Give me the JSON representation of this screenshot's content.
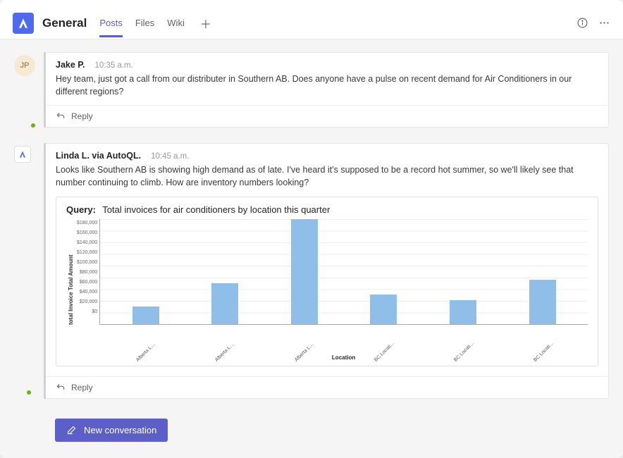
{
  "header": {
    "channel_name": "General",
    "tabs": [
      "Posts",
      "Files",
      "Wiki"
    ],
    "active_tab": 0
  },
  "messages": [
    {
      "avatar": {
        "type": "initials",
        "text": "JP",
        "presence": "available"
      },
      "author": "Jake P.",
      "time": "10:35 a.m.",
      "text": "Hey team, just got a call from our distributer in Southern AB. Does anyone have a pulse on recent demand for Air Conditioners in our different regions?",
      "reply_label": "Reply"
    },
    {
      "avatar": {
        "type": "bot",
        "presence": "available"
      },
      "author": "Linda L. via AutoQL.",
      "time": "10:45 a.m.",
      "text": "Looks like Southern AB is showing high demand as of late. I've heard it's supposed to be a record hot summer, so we'll likely see that number continuing to climb. How are inventory numbers looking?",
      "reply_label": "Reply",
      "chart": {
        "query_label": "Query:",
        "query_text": "Total invoices for air conditioners by location this quarter",
        "y_title": "total Invoice Total Amount",
        "x_title": "Location",
        "y_ticks": [
          "$180,000",
          "$160,000",
          "$140,000",
          "$120,000",
          "$100,000",
          "$80,000",
          "$60,000",
          "$40,000",
          "$20,000",
          "$0"
        ]
      }
    }
  ],
  "bottom": {
    "new_conversation": "New conversation"
  },
  "chart_data": {
    "type": "bar",
    "title": "Total invoices for air conditioners by location this quarter",
    "xlabel": "Location",
    "ylabel": "total Invoice Total Amount",
    "ylim": [
      0,
      180000
    ],
    "categories": [
      "Alberta Locations Ca...",
      "Alberta Locations Re...",
      "Alberta Locations So...",
      "BC Locations Central...",
      "BC Locations North B...",
      "BC Locations South B..."
    ],
    "values": [
      30000,
      70000,
      180000,
      50000,
      40000,
      75000
    ]
  }
}
